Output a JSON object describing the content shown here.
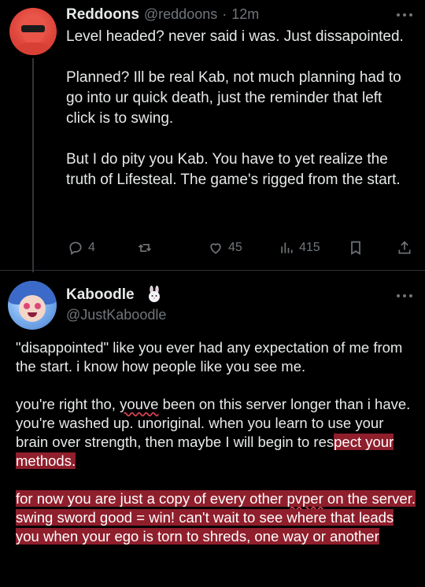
{
  "tweet1": {
    "display_name": "Reddoons",
    "handle": "@reddoons",
    "separator": "·",
    "time": "12m",
    "paragraphs": [
      "Level headed? never said i was. Just dissapointed.",
      "Planned? Ill be real Kab, not much planning had to go into ur quick death, just the reminder that left click is to swing.",
      "But I do pity you Kab. You have to yet realize the truth of Lifesteal. The game's rigged from the start."
    ],
    "replies": "4",
    "likes": "45",
    "views": "415",
    "icons": [
      "reply-icon",
      "retweet-icon",
      "like-icon",
      "views-icon",
      "bookmark-icon",
      "share-icon",
      "more-icon"
    ]
  },
  "tweet2": {
    "display_name": "Kaboodle",
    "handle": "@JustKaboodle",
    "p1": "\"disappointed\" like you ever had any expectation of me from the start. i know how people like you see me.",
    "p2_a": "you're right tho, ",
    "p2_youve": "youve",
    "p2_b": " been on this server longer than i have. you're washed up. unoriginal. when you learn to use your brain over strength, then maybe I will begin to res",
    "p2_hl": "pect your methods.",
    "p3_a": "for now you are just a copy of every other ",
    "p3_pvper": "pvper",
    "p3_b": " on the server. swing sword good = win! can't wait to see where that leads you when your ego is torn to shreds, one way or another",
    "highlight_color": "#8f1f2c",
    "icons": [
      "bunny-icon",
      "more-icon"
    ]
  },
  "colors": {
    "background": "#000000",
    "text": "#e7e9ea",
    "muted": "#71767b",
    "divider": "#2f3336"
  }
}
